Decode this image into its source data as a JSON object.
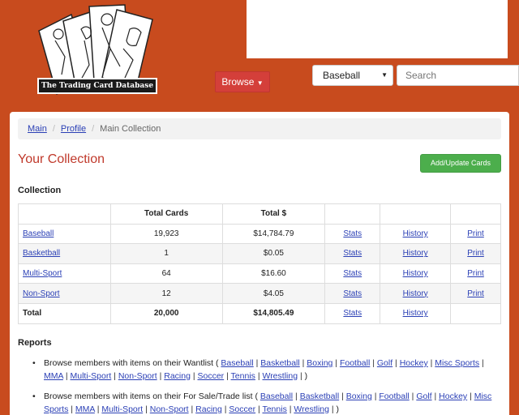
{
  "logo": {
    "text": "The Trading Card Database"
  },
  "nav": {
    "browse_label": "Browse",
    "sport_selected": "Baseball",
    "search_placeholder": "Search"
  },
  "breadcrumb": [
    {
      "label": "Main"
    },
    {
      "label": "Profile"
    },
    {
      "label": "Main Collection"
    }
  ],
  "page": {
    "title": "Your Collection",
    "add_button": "Add/Update Cards",
    "collection_heading": "Collection"
  },
  "table": {
    "headers": [
      "",
      "Total Cards",
      "Total $",
      "",
      "",
      ""
    ],
    "rows": [
      {
        "category": "Baseball",
        "cards": "19,923",
        "value": "$14,784.79",
        "stats": "Stats",
        "history": "History",
        "print": "Print"
      },
      {
        "category": "Basketball",
        "cards": "1",
        "value": "$0.05",
        "stats": "Stats",
        "history": "History",
        "print": "Print"
      },
      {
        "category": "Multi-Sport",
        "cards": "64",
        "value": "$16.60",
        "stats": "Stats",
        "history": "History",
        "print": "Print"
      },
      {
        "category": "Non-Sport",
        "cards": "12",
        "value": "$4.05",
        "stats": "Stats",
        "history": "History",
        "print": "Print"
      }
    ],
    "total": {
      "label": "Total",
      "cards": "20,000",
      "value": "$14,805.49",
      "stats": "Stats",
      "history": "History"
    }
  },
  "reports": {
    "heading": "Reports",
    "items": [
      {
        "text": "Browse members with items on their Wantlist (",
        "links": [
          "Baseball",
          "Basketball",
          "Boxing",
          "Football",
          "Golf",
          "Hockey",
          "Misc Sports",
          "MMA",
          "Multi-Sport",
          "Non-Sport",
          "Racing",
          "Soccer",
          "Tennis",
          "Wrestling"
        ],
        "close": ")"
      },
      {
        "text": "Browse members with items on their For Sale/Trade list (",
        "links": [
          "Baseball",
          "Basketball",
          "Boxing",
          "Football",
          "Golf",
          "Hockey",
          "Misc Sports",
          "MMA",
          "Multi-Sport",
          "Non-Sport",
          "Racing",
          "Soccer",
          "Tennis",
          "Wrestling"
        ],
        "close": ")"
      }
    ]
  },
  "colors": {
    "header_bg": "#c84b1e",
    "title_red": "#c0392b",
    "browse_btn": "#d43f3a",
    "add_btn": "#4cae4c",
    "link": "#2a3fb5"
  }
}
